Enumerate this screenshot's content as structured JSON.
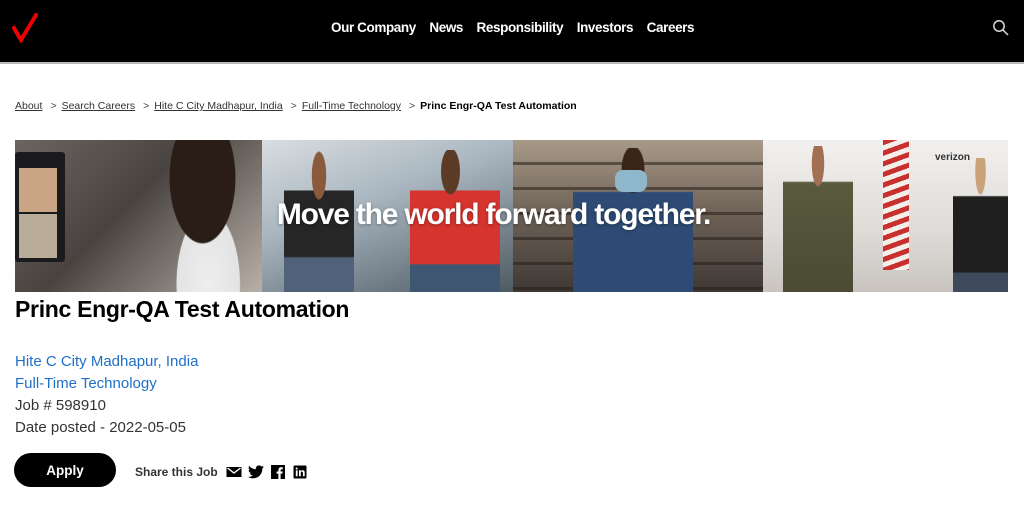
{
  "header": {
    "logo": "verizon-checkmark-logo",
    "brand_color": "#ee0000",
    "nav": [
      {
        "label": "Our Company"
      },
      {
        "label": "News"
      },
      {
        "label": "Responsibility"
      },
      {
        "label": "Investors"
      },
      {
        "label": "Careers"
      }
    ],
    "search_icon": "search-icon"
  },
  "breadcrumb": {
    "separator": ">",
    "items": [
      {
        "label": "About"
      },
      {
        "label": "Search Careers"
      },
      {
        "label": "Hite C City Madhapur, India"
      },
      {
        "label": "Full-Time Technology"
      }
    ],
    "current": "Princ Engr-QA Test Automation"
  },
  "banner": {
    "headline": "Move the world forward together.",
    "brand_mark": "verizon"
  },
  "job": {
    "title": "Princ Engr-QA Test Automation",
    "location": "Hite C City Madhapur, India",
    "category": "Full-Time Technology",
    "job_number": "Job # 598910",
    "date_posted": "Date posted - 2022-05-05",
    "link_color": "#1f6fc9"
  },
  "actions": {
    "apply_label": "Apply",
    "share_label": "Share this Job",
    "share_icons": [
      "email-icon",
      "twitter-icon",
      "facebook-icon",
      "linkedin-icon"
    ]
  }
}
